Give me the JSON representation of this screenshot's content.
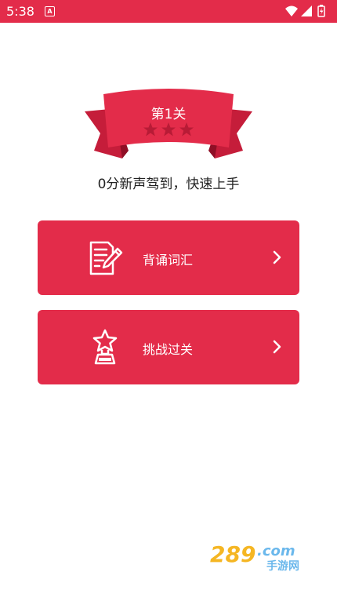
{
  "status_bar": {
    "time": "5:38",
    "notification_icon": "A",
    "icons": [
      "wifi-icon",
      "signal-icon",
      "battery-icon"
    ]
  },
  "level": {
    "title": "第1关",
    "stars_total": 3,
    "stars_earned": 0,
    "subtitle": "0分新声驾到，快速上手"
  },
  "options": [
    {
      "label": "背诵词汇",
      "icon": "document-pen-icon"
    },
    {
      "label": "挑战过关",
      "icon": "trophy-star-icon"
    }
  ],
  "watermark": {
    "text": "289.com 手游网"
  },
  "colors": {
    "accent": "#e32c4a",
    "ribbon_dark": "#c51d3a",
    "star_inactive": "#b81b36",
    "text_dark": "#222222"
  }
}
